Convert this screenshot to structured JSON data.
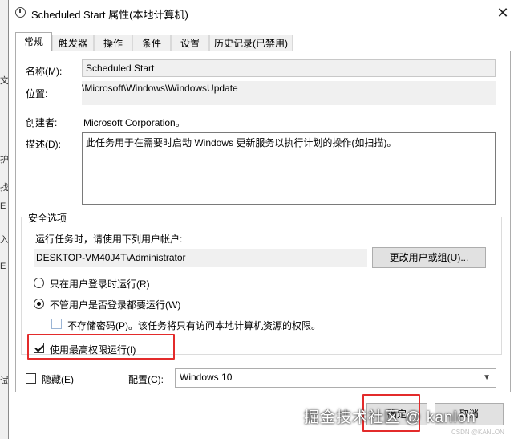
{
  "window": {
    "title": "Scheduled Start 属性(本地计算机)",
    "close_glyph": "✕"
  },
  "tabs": [
    {
      "label": "常规"
    },
    {
      "label": "触发器"
    },
    {
      "label": "操作"
    },
    {
      "label": "条件"
    },
    {
      "label": "设置"
    },
    {
      "label": "历史记录(已禁用)"
    }
  ],
  "general": {
    "name_label": "名称(M):",
    "name_value": "Scheduled Start",
    "location_label": "位置:",
    "location_value": "\\Microsoft\\Windows\\WindowsUpdate",
    "author_label": "创建者:",
    "author_value": "Microsoft Corporation。",
    "description_label": "描述(D):",
    "description_value": "此任务用于在需要时启动 Windows 更新服务以执行计划的操作(如扫描)。"
  },
  "security": {
    "group_title": "安全选项",
    "run_as_prompt": "运行任务时，请使用下列用户帐户:",
    "user_account": "DESKTOP-VM40J4T\\Administrator",
    "change_user_button": "更改用户或组(U)...",
    "radio_logged_on": "只在用户登录时运行(R)",
    "radio_whether_logged": "不管用户是否登录都要运行(W)",
    "no_store_password": "不存储密码(P)。该任务将只有访问本地计算机资源的权限。",
    "highest_privileges": "使用最高权限运行(I)",
    "radio_logged_on_selected": false,
    "radio_whether_logged_selected": true,
    "no_store_password_checked": false,
    "highest_privileges_checked": true
  },
  "bottom": {
    "hidden_label": "隐藏(E)",
    "hidden_checked": false,
    "configure_label": "配置(C):",
    "configure_value": "Windows 10",
    "ok_button": "确定",
    "cancel_button": "取消"
  },
  "background_chars": [
    "文",
    "护",
    "找",
    "E",
    "入",
    "E",
    "试"
  ],
  "watermark": {
    "main": "掘金技术社区 @ kanlon",
    "small": "CSDN @KANLON"
  },
  "colors": {
    "highlight_red": "#e32b2b",
    "button_face": "#e1e1e1",
    "panel_border": "#adadad"
  }
}
